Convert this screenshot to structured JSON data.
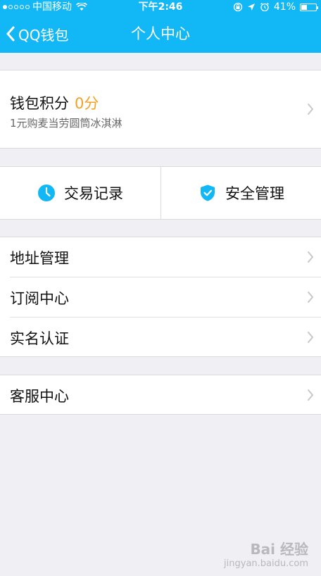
{
  "status_bar": {
    "carrier": "中国移动",
    "time": "下午2:46",
    "battery": "41%",
    "battery_level": 0.41
  },
  "nav": {
    "back_label": "QQ钱包",
    "title": "个人中心"
  },
  "wallet": {
    "label": "钱包积分",
    "points": "0分",
    "subtitle": "1元购麦当劳圆筒冰淇淋"
  },
  "actions": [
    {
      "label": "交易记录",
      "icon": "clock-icon"
    },
    {
      "label": "安全管理",
      "icon": "shield-check-icon"
    }
  ],
  "menu": {
    "items": [
      {
        "label": "地址管理"
      },
      {
        "label": "订阅中心"
      },
      {
        "label": "实名认证"
      }
    ]
  },
  "service": {
    "label": "客服中心"
  },
  "watermark": {
    "brand": "Bai 经验",
    "url": "jingyan.baidu.com"
  },
  "colors": {
    "header": "#12b7f5",
    "accent_points": "#f3a023",
    "icon_blue": "#12b7f5",
    "background": "#efeff4"
  }
}
